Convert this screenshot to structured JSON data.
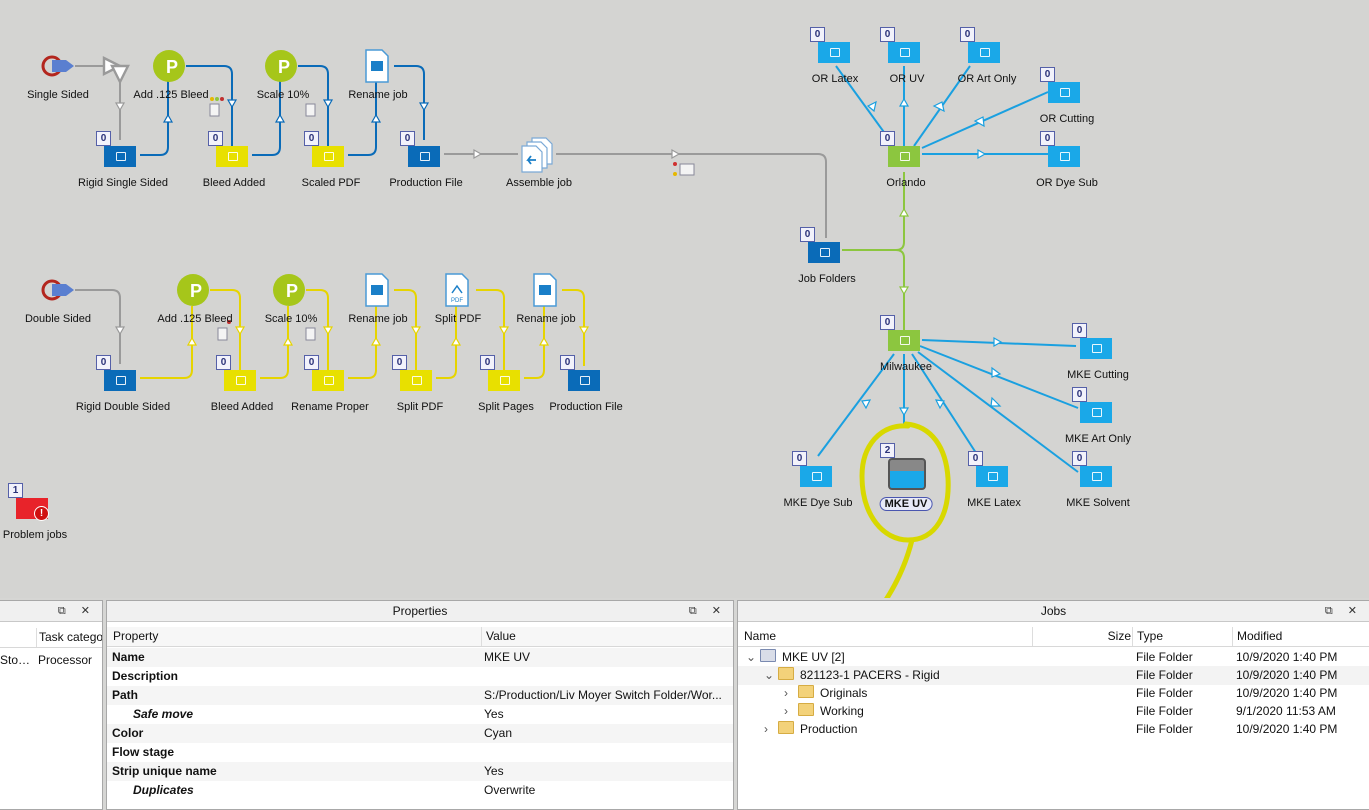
{
  "flow": {
    "nodes": {
      "single_sided": "Single Sided",
      "rigid_single_sided": "Rigid Single Sided",
      "add_bleed_1": "Add .125 Bleed",
      "bleed_added_1": "Bleed Added",
      "scale_1": "Scale 10%",
      "scaled_pdf": "Scaled PDF",
      "rename_job_1": "Rename job",
      "production_file_1": "Production File",
      "assemble_job": "Assemble job",
      "double_sided": "Double Sided",
      "rigid_double_sided": "Rigid Double Sided",
      "add_bleed_2": "Add .125 Bleed",
      "bleed_added_2": "Bleed Added",
      "scale_2": "Scale 10%",
      "rename_proper": "Rename Proper",
      "rename_job_2": "Rename job",
      "split_pdf_tool": "Split PDF",
      "split_pdf_folder": "Split PDF",
      "rename_job_3": "Rename job",
      "split_pages": "Split Pages",
      "production_file_2": "Production File",
      "problem_jobs": "Problem jobs",
      "job_folders": "Job Folders",
      "orlando": "Orlando",
      "or_latex": "OR Latex",
      "or_uv": "OR UV",
      "or_art_only": "OR Art Only",
      "or_cutting": "OR Cutting",
      "or_dye_sub": "OR Dye Sub",
      "milwaukee": "Milwaukee",
      "mke_cutting": "MKE Cutting",
      "mke_art_only": "MKE Art Only",
      "mke_solvent": "MKE Solvent",
      "mke_latex": "MKE Latex",
      "mke_uv": "MKE UV",
      "mke_dye_sub": "MKE Dye Sub"
    },
    "counts": {
      "zero": "0",
      "mke_uv": "2",
      "problem_jobs": "1"
    },
    "pdf_glyph": "PDF",
    "colors": {
      "blue_folder": "#0a6bb8",
      "yellow_folder": "#e8e000",
      "cyan_folder": "#1aa8e8",
      "green_folder": "#8cc63f",
      "red_folder": "#e8232a",
      "blue_line": "#0a6bb8",
      "yellow_line": "#e6d400",
      "cyan_line": "#1aa0e0",
      "green_line": "#8cc63f",
      "highlight": "#d8d800"
    }
  },
  "left_panel": {
    "col_task_category": "Task catego",
    "row1_col1": "Stop...",
    "row1_col2": "Processor"
  },
  "properties": {
    "title": "Properties",
    "col_property": "Property",
    "col_value": "Value",
    "rows": [
      {
        "name": "Name",
        "value": "MKE UV"
      },
      {
        "name": "Description",
        "value": ""
      },
      {
        "name": "Path",
        "value": "S:/Production/Liv Moyer Switch Folder/Wor..."
      },
      {
        "name": "Safe move",
        "value": "Yes"
      },
      {
        "name": "Color",
        "value": "Cyan"
      },
      {
        "name": "Flow stage",
        "value": ""
      },
      {
        "name": "Strip unique name",
        "value": "Yes"
      },
      {
        "name": "Duplicates",
        "value": "Overwrite"
      }
    ]
  },
  "jobs": {
    "title": "Jobs",
    "col_name": "Name",
    "col_size": "Size",
    "col_type": "Type",
    "col_modified": "Modified",
    "rows": [
      {
        "name": "MKE UV [2]",
        "type": "File Folder",
        "modified": "10/9/2020 1:40 PM"
      },
      {
        "name": "821123-1 PACERS - Rigid",
        "type": "File Folder",
        "modified": "10/9/2020 1:40 PM"
      },
      {
        "name": "Originals",
        "type": "File Folder",
        "modified": "10/9/2020 1:40 PM"
      },
      {
        "name": "Working",
        "type": "File Folder",
        "modified": "9/1/2020 11:53 AM"
      },
      {
        "name": "Production",
        "type": "File Folder",
        "modified": "10/9/2020 1:40 PM"
      }
    ]
  }
}
